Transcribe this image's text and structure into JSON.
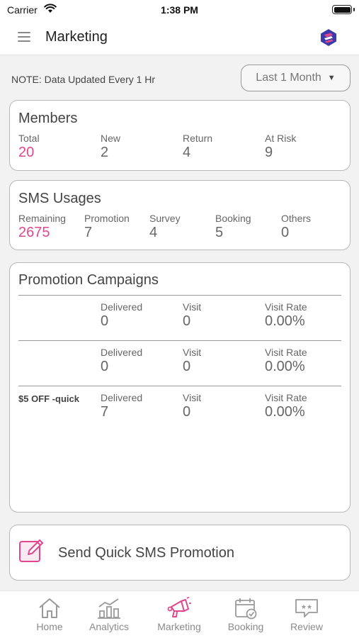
{
  "status_bar": {
    "carrier": "Carrier",
    "time": "1:38 PM"
  },
  "header": {
    "title": "Marketing"
  },
  "note": "NOTE: Data Updated Every 1 Hr",
  "range_filter": {
    "label": "Last 1 Month"
  },
  "members": {
    "title": "Members",
    "stats": [
      {
        "label": "Total",
        "value": "20"
      },
      {
        "label": "New",
        "value": "2"
      },
      {
        "label": "Return",
        "value": "4"
      },
      {
        "label": "At Risk",
        "value": "9"
      }
    ]
  },
  "sms": {
    "title": "SMS Usages",
    "stats": [
      {
        "label": "Remaining",
        "value": "2675"
      },
      {
        "label": "Promotion",
        "value": "7"
      },
      {
        "label": "Survey",
        "value": "4"
      },
      {
        "label": "Booking",
        "value": "5"
      },
      {
        "label": "Others",
        "value": "0"
      }
    ]
  },
  "promotions": {
    "title": "Promotion Campaigns",
    "rows": [
      {
        "name": "",
        "delivered_label": "Delivered",
        "delivered": "0",
        "visit_label": "Visit",
        "visit": "0",
        "rate_label": "Visit Rate",
        "rate": "0.00%"
      },
      {
        "name": "",
        "delivered_label": "Delivered",
        "delivered": "0",
        "visit_label": "Visit",
        "visit": "0",
        "rate_label": "Visit Rate",
        "rate": "0.00%"
      },
      {
        "name": "$5 OFF -quick",
        "delivered_label": "Delivered",
        "delivered": "7",
        "visit_label": "Visit",
        "visit": "0",
        "rate_label": "Visit Rate",
        "rate": "0.00%"
      }
    ]
  },
  "quick_sms": {
    "label": "Send Quick SMS Promotion"
  },
  "tabs": [
    {
      "label": "Home",
      "icon": "home-icon",
      "active": false
    },
    {
      "label": "Analytics",
      "icon": "analytics-icon",
      "active": false
    },
    {
      "label": "Marketing",
      "icon": "megaphone-icon",
      "active": true
    },
    {
      "label": "Booking",
      "icon": "calendar-check-icon",
      "active": false
    },
    {
      "label": "Review",
      "icon": "review-icon",
      "active": false
    }
  ],
  "colors": {
    "accent": "#e0478d",
    "logo_blue": "#3a3aa8"
  }
}
